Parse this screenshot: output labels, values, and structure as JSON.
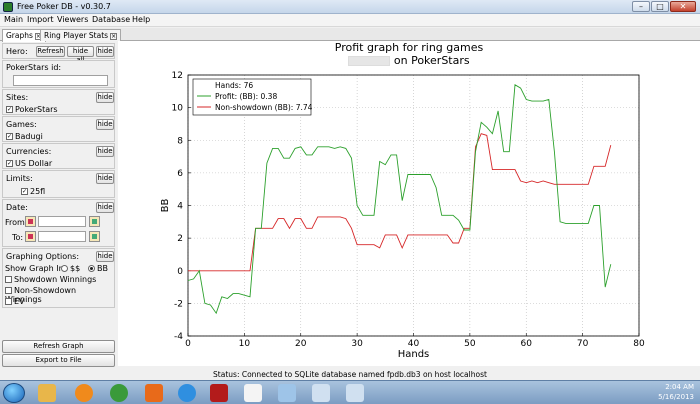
{
  "window": {
    "title": "Free Poker DB - v0.30.7",
    "min": "–",
    "max": "□",
    "close": "✕"
  },
  "menu": [
    "Main",
    "Import",
    "Viewers",
    "Database",
    "Help"
  ],
  "tabs": [
    {
      "label": "Graphs",
      "active": true
    },
    {
      "label": "Ring Player Stats",
      "active": false
    }
  ],
  "sidebar": {
    "hero": {
      "label": "Hero:",
      "refresh": "Refresh",
      "hide_all": "hide all",
      "hide": "hide"
    },
    "pokerstars_id": {
      "label": "PokerStars id:",
      "value": ""
    },
    "sites": {
      "label": "Sites:",
      "hide": "hide",
      "items": [
        {
          "label": "PokerStars",
          "checked": true
        }
      ]
    },
    "games": {
      "label": "Games:",
      "hide": "hide",
      "items": [
        {
          "label": "Badugi",
          "checked": true
        }
      ]
    },
    "currencies": {
      "label": "Currencies:",
      "hide": "hide",
      "items": [
        {
          "label": "US Dollar",
          "checked": true
        }
      ]
    },
    "limits": {
      "label": "Limits:",
      "hide": "hide",
      "items": [
        {
          "label": "25fl",
          "checked": true
        }
      ]
    },
    "date": {
      "label": "Date:",
      "hide": "hide",
      "from": "From:",
      "to": "To:"
    },
    "graphing": {
      "label": "Graphing Options:",
      "hide": "hide",
      "show_in": "Show Graph In:",
      "opt_dollars": "$$",
      "opt_bb": "BB",
      "selected": "BB",
      "options": [
        {
          "label": "Showdown Winnings",
          "checked": false
        },
        {
          "label": "Non-Showdown Winnings",
          "checked": false
        },
        {
          "label": "EV",
          "checked": false
        }
      ]
    },
    "refresh_graph": "Refresh Graph",
    "export": "Export to File"
  },
  "chart_data": {
    "type": "line",
    "title": "Profit graph for ring games",
    "subtitle": "on PokerStars",
    "xlabel": "Hands",
    "ylabel": "BB",
    "xlim": [
      0,
      80
    ],
    "ylim": [
      -4,
      12
    ],
    "xticks": [
      0,
      10,
      20,
      30,
      40,
      50,
      60,
      70,
      80
    ],
    "yticks": [
      -4,
      -2,
      0,
      2,
      4,
      6,
      8,
      10,
      12
    ],
    "grid": true,
    "legend_position": "top-left",
    "legend": [
      "Hands: 76",
      "Profit: (BB): 0.38",
      "Non-showdown (BB): 7.74"
    ],
    "series": [
      {
        "name": "Profit: (BB): 0.38",
        "color": "#2ca02c",
        "x": [
          0,
          1,
          2,
          3,
          4,
          5,
          6,
          7,
          8,
          9,
          10,
          11,
          12,
          13,
          14,
          15,
          16,
          17,
          18,
          19,
          20,
          21,
          22,
          23,
          24,
          25,
          26,
          27,
          28,
          29,
          30,
          31,
          32,
          33,
          34,
          35,
          36,
          37,
          38,
          39,
          40,
          41,
          42,
          43,
          44,
          45,
          46,
          47,
          48,
          49,
          50,
          51,
          52,
          53,
          54,
          55,
          56,
          57,
          58,
          59,
          60,
          61,
          62,
          63,
          64,
          65,
          66,
          67,
          68,
          69,
          70,
          71,
          72,
          73,
          74,
          75
        ],
        "y": [
          -0.6,
          -0.5,
          0,
          -2,
          -2.1,
          -2.6,
          -1.6,
          -1.7,
          -1.4,
          -1.4,
          -1.5,
          -1.6,
          2.6,
          2.6,
          6.6,
          7.5,
          7.5,
          6.9,
          6.9,
          7.5,
          7.6,
          7.1,
          7.1,
          7.6,
          7.6,
          7.6,
          7.5,
          7.6,
          7.5,
          6.9,
          4,
          3.4,
          3.4,
          3.4,
          6.7,
          6.5,
          7.1,
          7.1,
          4.3,
          5.9,
          5.9,
          5.9,
          5.9,
          5.9,
          5.1,
          3.4,
          3.4,
          3.4,
          3.1,
          2.5,
          2.5,
          7.3,
          9.1,
          8.8,
          8.4,
          9.8,
          7.3,
          7.3,
          11.4,
          11.2,
          10.5,
          10.4,
          10.4,
          10.4,
          10.5,
          7.3,
          3,
          2.9,
          2.9,
          2.9,
          2.9,
          2.9,
          4,
          4,
          -1,
          0.4
        ]
      },
      {
        "name": "Non-showdown (BB): 7.74",
        "color": "#d62728",
        "x": [
          0,
          1,
          2,
          3,
          4,
          5,
          6,
          7,
          8,
          9,
          10,
          11,
          12,
          13,
          14,
          15,
          16,
          17,
          18,
          19,
          20,
          21,
          22,
          23,
          24,
          25,
          26,
          27,
          28,
          29,
          30,
          31,
          32,
          33,
          34,
          35,
          36,
          37,
          38,
          39,
          40,
          41,
          42,
          43,
          44,
          45,
          46,
          47,
          48,
          49,
          50,
          51,
          52,
          53,
          54,
          55,
          56,
          57,
          58,
          59,
          60,
          61,
          62,
          63,
          64,
          65,
          66,
          67,
          68,
          69,
          70,
          71,
          72,
          73,
          74,
          75
        ],
        "y": [
          0,
          0,
          0,
          0,
          0,
          0,
          0,
          0,
          0,
          0,
          0,
          0,
          2.6,
          2.6,
          2.6,
          2.6,
          3.2,
          3.2,
          2.6,
          3.2,
          3.2,
          2.6,
          2.6,
          3.3,
          3.3,
          3.3,
          3.3,
          3.3,
          3.2,
          2.6,
          1.6,
          1.6,
          1.6,
          1.6,
          1.4,
          2.2,
          2.2,
          2.2,
          1.4,
          2.2,
          2.2,
          2.2,
          2.2,
          2.2,
          2.2,
          2.2,
          2.2,
          1.7,
          1.7,
          2.6,
          2.6,
          7.6,
          8.4,
          8.3,
          6.2,
          6.2,
          6.2,
          6.2,
          6.2,
          5.5,
          5.4,
          5.5,
          5.4,
          5.5,
          5.4,
          5.3,
          5.3,
          5.3,
          5.3,
          5.3,
          5.3,
          5.3,
          6.4,
          6.4,
          6.4,
          7.7
        ]
      }
    ]
  },
  "status": "Status: Connected to SQLite database named fpdb.db3 on host localhost",
  "taskbar": {
    "time": "2:04 AM",
    "date": "5/16/2013"
  }
}
